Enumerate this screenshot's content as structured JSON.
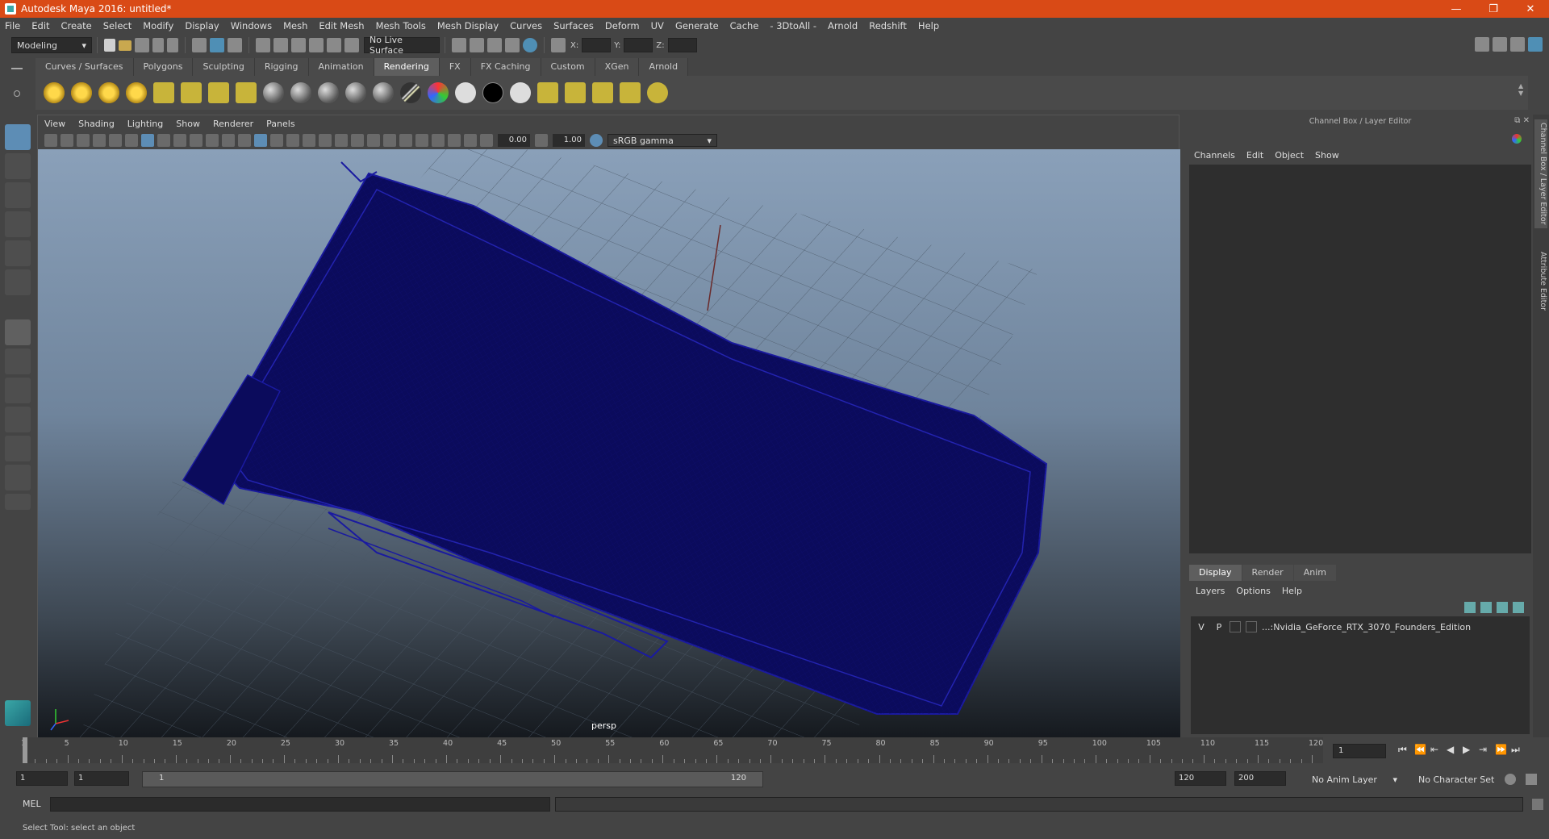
{
  "window": {
    "title": "Autodesk Maya 2016: untitled*",
    "controls": [
      "—",
      "❐",
      "✕"
    ]
  },
  "menubar": [
    "File",
    "Edit",
    "Create",
    "Select",
    "Modify",
    "Display",
    "Windows",
    "Mesh",
    "Edit Mesh",
    "Mesh Tools",
    "Mesh Display",
    "Curves",
    "Surfaces",
    "Deform",
    "UV",
    "Generate",
    "Cache",
    "- 3DtoAll -",
    "Arnold",
    "Redshift",
    "Help"
  ],
  "statusline": {
    "mode": "Modeling",
    "live_surface": "No Live Surface",
    "x_label": "X:",
    "y_label": "Y:",
    "z_label": "Z:"
  },
  "shelf_tabs": [
    "Curves / Surfaces",
    "Polygons",
    "Sculpting",
    "Rigging",
    "Animation",
    "Rendering",
    "FX",
    "FX Caching",
    "Custom",
    "XGen",
    "Arnold"
  ],
  "active_shelf": "Rendering",
  "viewport": {
    "menu": [
      "View",
      "Shading",
      "Lighting",
      "Show",
      "Renderer",
      "Panels"
    ],
    "exposure": "0.00",
    "gamma": "1.00",
    "color_space": "sRGB gamma",
    "camera_label": "persp"
  },
  "channel_box": {
    "title": "Channel Box / Layer Editor",
    "menu": [
      "Channels",
      "Edit",
      "Object",
      "Show"
    ]
  },
  "layer_editor": {
    "tabs": [
      "Display",
      "Render",
      "Anim"
    ],
    "active_tab": "Display",
    "menu": [
      "Layers",
      "Options",
      "Help"
    ],
    "layer": {
      "v": "V",
      "p": "P",
      "name": "...:Nvidia_GeForce_RTX_3070_Founders_Edition"
    }
  },
  "side_tabs": {
    "channel_box": "Channel Box / Layer Editor",
    "attribute_editor": "Attribute Editor"
  },
  "timeline": {
    "labels": [
      "1",
      "5",
      "10",
      "15",
      "20",
      "25",
      "30",
      "35",
      "40",
      "45",
      "50",
      "55",
      "60",
      "65",
      "70",
      "75",
      "80",
      "85",
      "90",
      "95",
      "100",
      "105",
      "110",
      "115",
      "120"
    ],
    "current_frame": "1"
  },
  "range": {
    "start": "1",
    "playback_start": "1",
    "slider_start": "1",
    "slider_end": "120",
    "playback_end": "120",
    "end": "200",
    "anim_layer": "No Anim Layer",
    "character_set": "No Character Set"
  },
  "command_line": {
    "label": "MEL"
  },
  "help_line": "Select Tool: select an object"
}
